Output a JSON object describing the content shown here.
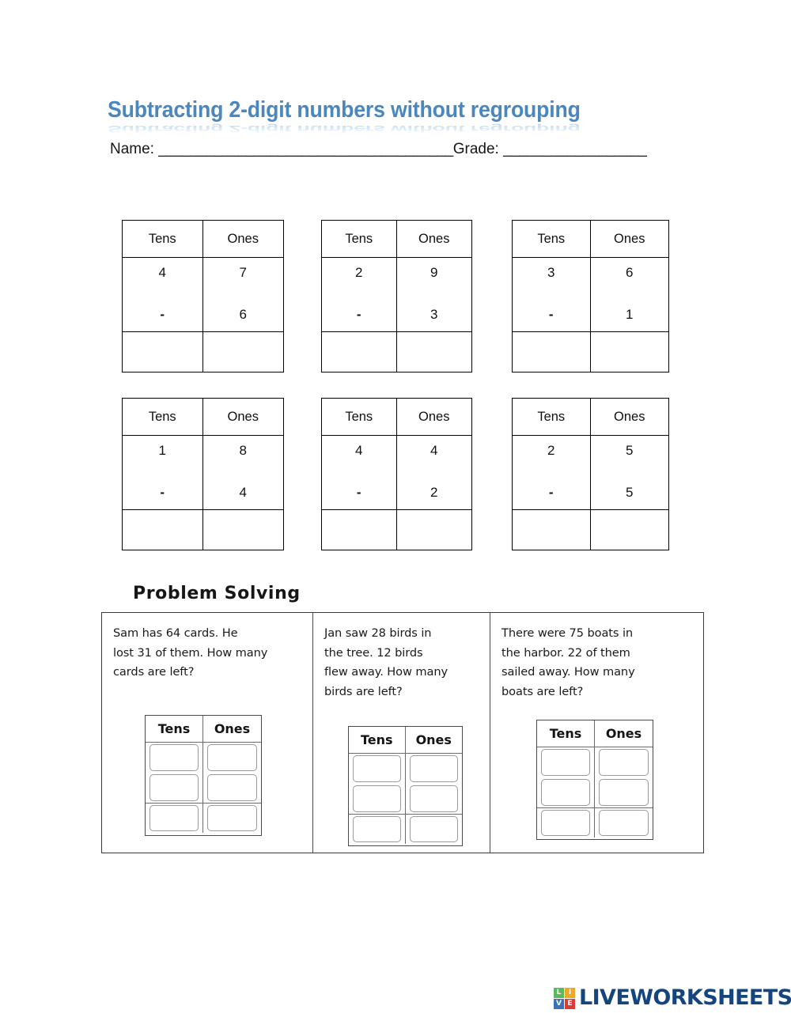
{
  "worksheet": {
    "title": "Subtracting 2-digit numbers without regrouping",
    "title_color": "#4a87bf",
    "name_label": "Name: ",
    "name_rule": "_____________________________________",
    "grade_label": "Grade: ",
    "grade_rule": "__________________",
    "problem_solving_heading": "Problem Solving"
  },
  "column_headers": {
    "tens": "Tens",
    "ones": "Ones"
  },
  "operator": "-",
  "exercises": [
    {
      "tens_top": "4",
      "ones_top": "7",
      "tens_bottom": "-",
      "ones_bottom": "6"
    },
    {
      "tens_top": "2",
      "ones_top": "9",
      "tens_bottom": "-",
      "ones_bottom": "3"
    },
    {
      "tens_top": "3",
      "ones_top": "6",
      "tens_bottom": "-",
      "ones_bottom": "1"
    },
    {
      "tens_top": "1",
      "ones_top": "8",
      "tens_bottom": "-",
      "ones_bottom": "4"
    },
    {
      "tens_top": "4",
      "ones_top": "4",
      "tens_bottom": "-",
      "ones_bottom": "2"
    },
    {
      "tens_top": "2",
      "ones_top": "5",
      "tens_bottom": "-",
      "ones_bottom": "5"
    }
  ],
  "word_problems": [
    {
      "text": "Sam has 64 cards.  He\nlost 31 of them. How many\ncards are left?"
    },
    {
      "text": "Jan saw 28 birds in\nthe tree.  12 birds\nflew away. How many\nbirds are left?"
    },
    {
      "text": "There were 75 boats in\nthe harbor.  22 of them\nsailed away. How many\nboats are left?"
    }
  ],
  "logo": {
    "word": "LIVEWORKSHEETS",
    "word_color": "#14457e",
    "tiles": [
      {
        "letter": "L",
        "color": "#5bb85c"
      },
      {
        "letter": "I",
        "color": "#f0a828"
      },
      {
        "letter": "V",
        "color": "#3a72b8"
      },
      {
        "letter": "E",
        "color": "#e03b32"
      }
    ]
  }
}
